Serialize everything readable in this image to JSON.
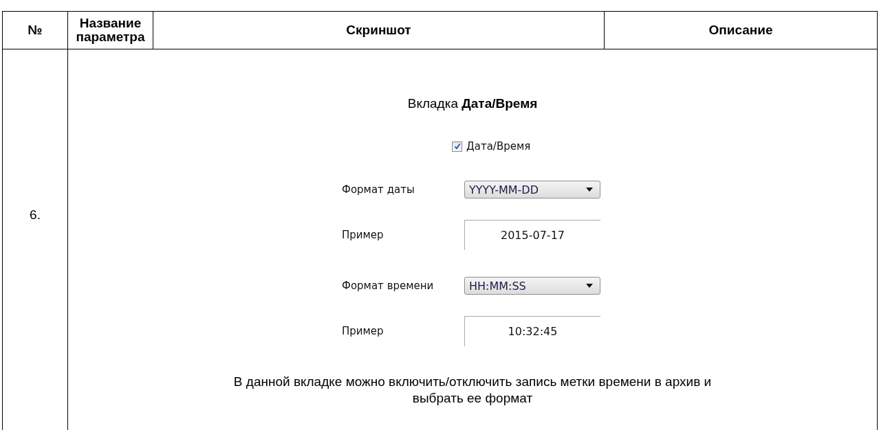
{
  "table": {
    "columns": [
      "№",
      "Название параметра",
      "Скриншот",
      "Описание"
    ],
    "rows": [
      {
        "number": "6.",
        "tab_caption": "Вкладка **Дата/Время**",
        "dialog": {
          "checkbox": {
            "label": "Дата/Время",
            "checked": true
          },
          "fields": [
            {
              "kind": "dropdown",
              "label": "Формат даты",
              "value": "YYYY-MM-DD"
            },
            {
              "kind": "example",
              "label": "Пример",
              "value": "2015-07-17"
            },
            {
              "kind": "dropdown",
              "label": "Формат времени",
              "value": "HH:MM:SS"
            },
            {
              "kind": "example",
              "label": "Пример",
              "value": "10:32:45"
            }
          ]
        },
        "description": "В данной вкладке можно включить/отключить запись метки времени в архив и выбрать ее формат"
      }
    ]
  }
}
